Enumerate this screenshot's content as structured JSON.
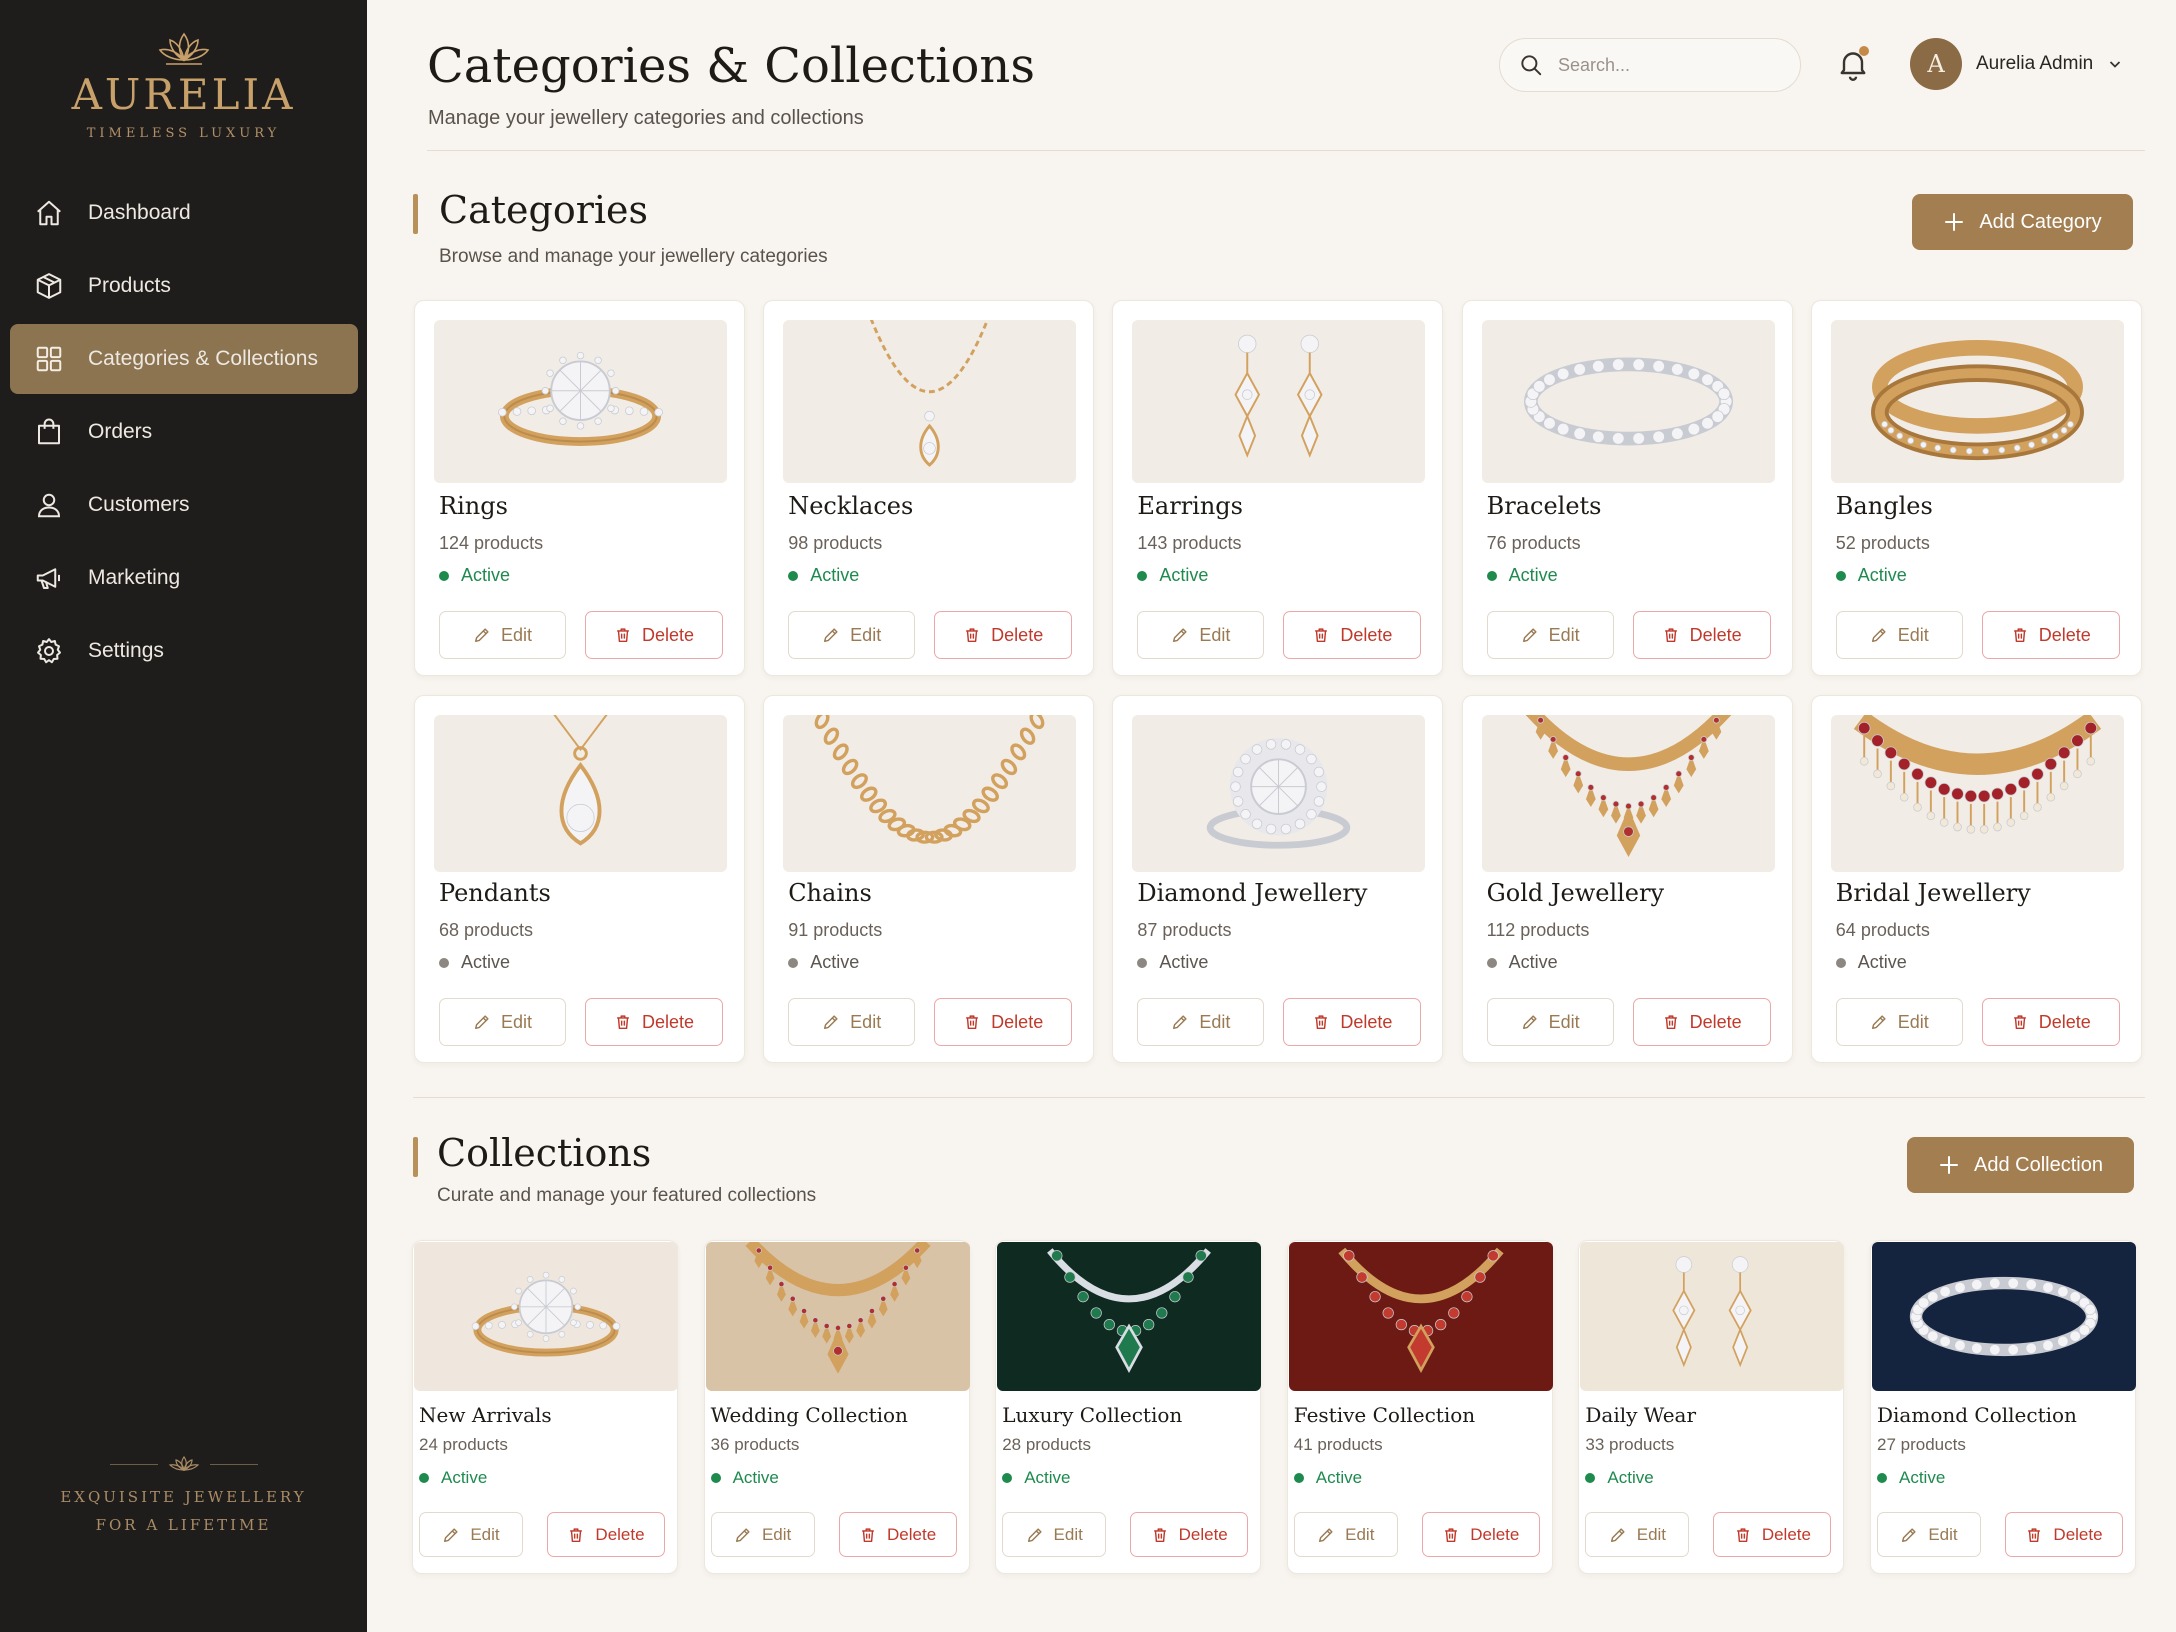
{
  "brand": {
    "name": "AURELIA",
    "tagline": "TIMELESS LUXURY",
    "footer_line1": "EXQUISITE JEWELLERY",
    "footer_line2": "FOR A LIFETIME",
    "accent": "#A27E50"
  },
  "nav": [
    {
      "label": "Dashboard",
      "icon": "home-icon"
    },
    {
      "label": "Products",
      "icon": "box-icon"
    },
    {
      "label": "Categories & Collections",
      "icon": "grid-icon",
      "active": true
    },
    {
      "label": "Orders",
      "icon": "bag-icon"
    },
    {
      "label": "Customers",
      "icon": "user-icon"
    },
    {
      "label": "Marketing",
      "icon": "megaphone-icon"
    },
    {
      "label": "Settings",
      "icon": "gear-icon"
    }
  ],
  "header": {
    "title": "Categories & Collections",
    "subtitle": "Manage your jewellery categories and collections",
    "search_placeholder": "Search...",
    "user_initial": "A",
    "user_name": "Aurelia Admin"
  },
  "categories": {
    "title": "Categories",
    "subtitle": "Browse and manage your jewellery categories",
    "add_label": "Add Category",
    "edit_label": "Edit",
    "delete_label": "Delete",
    "items": [
      {
        "name": "Rings",
        "count": "124 products",
        "status": "Active",
        "active": true,
        "art": "ring"
      },
      {
        "name": "Necklaces",
        "count": "98 products",
        "status": "Active",
        "active": true,
        "art": "necklace"
      },
      {
        "name": "Earrings",
        "count": "143 products",
        "status": "Active",
        "active": true,
        "art": "earrings"
      },
      {
        "name": "Bracelets",
        "count": "76 products",
        "status": "Active",
        "active": true,
        "art": "bracelet"
      },
      {
        "name": "Bangles",
        "count": "52 products",
        "status": "Active",
        "active": true,
        "art": "bangle"
      },
      {
        "name": "Pendants",
        "count": "68 products",
        "status": "Active",
        "active": false,
        "art": "pendant"
      },
      {
        "name": "Chains",
        "count": "91 products",
        "status": "Active",
        "active": false,
        "art": "chain"
      },
      {
        "name": "Diamond Jewellery",
        "count": "87 products",
        "status": "Active",
        "active": false,
        "art": "diamondring"
      },
      {
        "name": "Gold Jewellery",
        "count": "112 products",
        "status": "Active",
        "active": false,
        "art": "goldnecklace"
      },
      {
        "name": "Bridal Jewellery",
        "count": "64 products",
        "status": "Active",
        "active": false,
        "art": "bridal"
      }
    ]
  },
  "collections": {
    "title": "Collections",
    "subtitle": "Curate and manage your featured collections",
    "add_label": "Add Collection",
    "edit_label": "Edit",
    "delete_label": "Delete",
    "items": [
      {
        "name": "New Arrivals",
        "count": "24 products",
        "status": "Active",
        "art": "ring",
        "bg": "#EFE7DD"
      },
      {
        "name": "Wedding Collection",
        "count": "36 products",
        "status": "Active",
        "art": "goldnecklace",
        "bg": "#D9C3A6"
      },
      {
        "name": "Luxury Collection",
        "count": "28 products",
        "status": "Active",
        "art": "emerald",
        "bg": "#0F2A20"
      },
      {
        "name": "Festive Collection",
        "count": "41 products",
        "status": "Active",
        "art": "ruby",
        "bg": "#6E1A14"
      },
      {
        "name": "Daily Wear",
        "count": "33 products",
        "status": "Active",
        "art": "earrings",
        "bg": "#EFE6DA"
      },
      {
        "name": "Diamond Collection",
        "count": "27 products",
        "status": "Active",
        "art": "bracelet",
        "bg": "#14233E"
      }
    ]
  }
}
